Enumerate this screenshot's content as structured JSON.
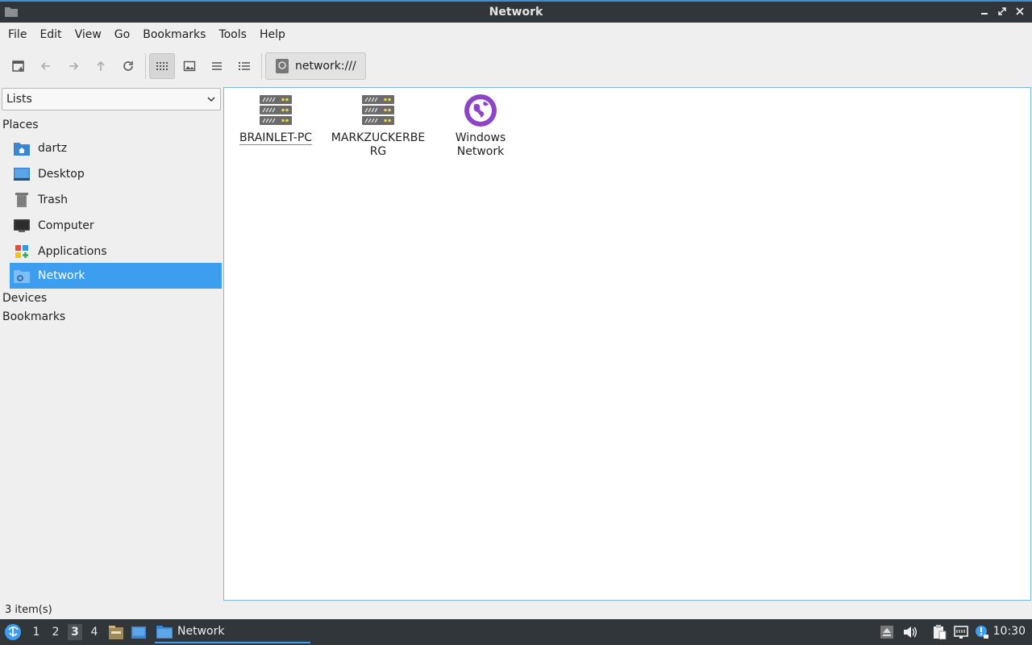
{
  "window": {
    "title": "Network"
  },
  "menu": [
    "File",
    "Edit",
    "View",
    "Go",
    "Bookmarks",
    "Tools",
    "Help"
  ],
  "location": {
    "path": "network:///"
  },
  "sidebar": {
    "mode": "Lists",
    "headers": {
      "places": "Places",
      "devices": "Devices",
      "bookmarks": "Bookmarks"
    },
    "places": [
      {
        "label": "dartz",
        "icon": "home-folder-icon"
      },
      {
        "label": "Desktop",
        "icon": "desktop-icon"
      },
      {
        "label": "Trash",
        "icon": "trash-icon"
      },
      {
        "label": "Computer",
        "icon": "computer-icon"
      },
      {
        "label": "Applications",
        "icon": "applications-icon"
      },
      {
        "label": "Network",
        "icon": "network-icon",
        "selected": true
      }
    ]
  },
  "files": [
    {
      "label": "BRAINLET-PC",
      "icon": "server-icon"
    },
    {
      "label": "MARKZUCKERBERG",
      "icon": "server-icon"
    },
    {
      "label": "Windows Network",
      "icon": "globe-icon"
    }
  ],
  "status": {
    "text": "3 item(s)"
  },
  "taskbar": {
    "workspaces": [
      "1",
      "2",
      "3",
      "4"
    ],
    "active_workspace": "3",
    "task_label": "Network",
    "clock": "10:30"
  },
  "colors": {
    "accent": "#3d9ef0",
    "titlebar": "#31363b",
    "globe": "#8e44c6"
  }
}
